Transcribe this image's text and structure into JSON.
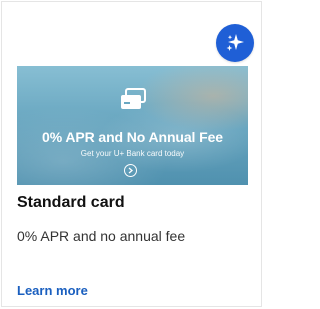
{
  "badge": {
    "icon": "sparkle-icon",
    "color": "#1f5fd6"
  },
  "promo": {
    "icon": "credit-card-icon",
    "headline": "0% APR and No Annual Fee",
    "subline": "Get your U+ Bank card today",
    "arrow_icon": "chevron-right-circle-icon"
  },
  "card": {
    "title": "Standard card",
    "description": "0% APR and no annual fee",
    "link_label": "Learn more",
    "link_color": "#1a5fbf"
  }
}
